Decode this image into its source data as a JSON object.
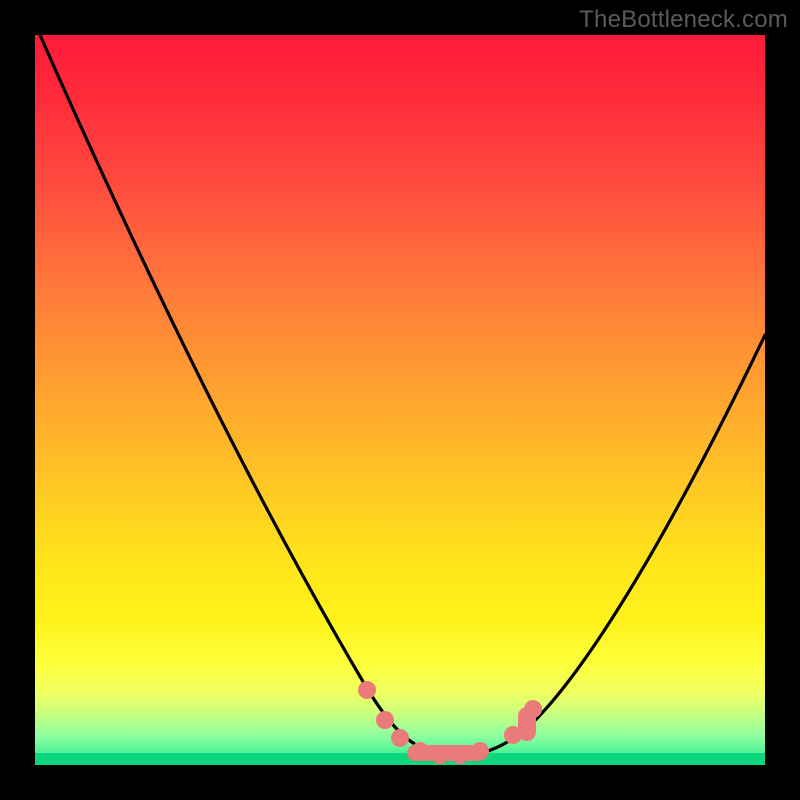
{
  "watermark": "TheBottleneck.com",
  "colors": {
    "frame_bg": "#000000",
    "curve_stroke": "#000000",
    "marker_fill": "#eb7b7b",
    "gradient_top": "#ff1a3a",
    "gradient_bottom": "#20e890"
  },
  "chart_data": {
    "type": "line",
    "title": "",
    "xlabel": "",
    "ylabel": "",
    "xlim": [
      0,
      100
    ],
    "ylim": [
      0,
      100
    ],
    "x": [
      0,
      5,
      10,
      15,
      20,
      25,
      30,
      35,
      40,
      45,
      50,
      52,
      54,
      56,
      58,
      60,
      62,
      65,
      70,
      75,
      80,
      85,
      90,
      95,
      100
    ],
    "y": [
      100,
      93,
      85,
      76,
      68,
      59,
      50,
      42,
      33,
      24,
      14,
      10,
      7,
      4,
      2,
      1,
      1,
      2,
      5,
      12,
      21,
      30,
      40,
      50,
      60
    ],
    "markers": {
      "x": [
        50,
        52,
        54,
        56,
        58,
        60,
        62,
        64,
        66,
        68
      ],
      "y": [
        12,
        8,
        5,
        3,
        2,
        1,
        1,
        2,
        4,
        7
      ]
    },
    "note": "Values estimated from pixel positions; axes unlabeled in source image."
  }
}
